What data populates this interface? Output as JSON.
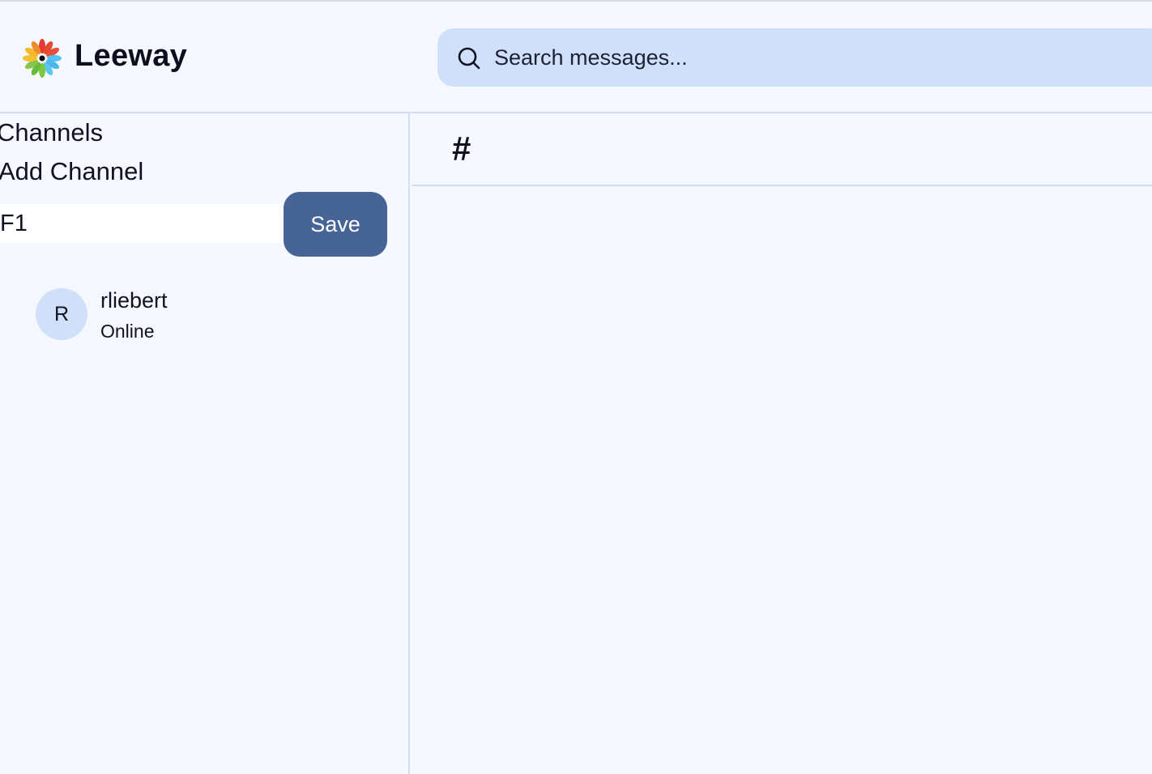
{
  "header": {
    "brand": "Leeway",
    "search": {
      "placeholder": "Search messages...",
      "value": ""
    }
  },
  "sidebar": {
    "heading": "Channels",
    "add_channel_label": "Add Channel",
    "channel_input_value": "F1",
    "save_label": "Save",
    "users": [
      {
        "initial": "R",
        "name": "rliebert",
        "status": "Online"
      }
    ]
  },
  "main": {
    "hash_symbol": "#",
    "channel_name": ""
  },
  "colors": {
    "background": "#f5f9ff",
    "search_bg": "#d0e0fb",
    "save_button": "#466495",
    "divider": "#d2dff0"
  },
  "icons": {
    "logo": "flower-logo-icon",
    "search": "search-icon",
    "channel": "hash-icon"
  }
}
